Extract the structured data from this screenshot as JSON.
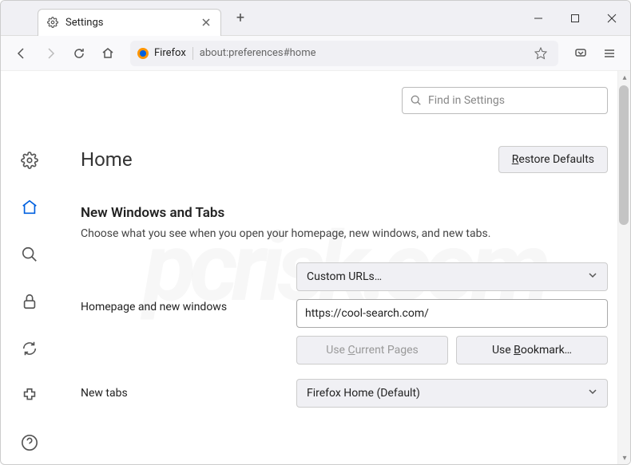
{
  "tab": {
    "title": "Settings"
  },
  "urlbar": {
    "identity": "Firefox",
    "url": "about:preferences#home"
  },
  "search": {
    "placeholder": "Find in Settings"
  },
  "page": {
    "title": "Home",
    "restore_label": "Restore Defaults"
  },
  "section": {
    "title": "New Windows and Tabs",
    "desc": "Choose what you see when you open your homepage, new windows, and new tabs."
  },
  "form": {
    "homepage_label": "Homepage and new windows",
    "homepage_mode": "Custom URLs…",
    "homepage_url": "https://cool-search.com/",
    "use_current": "Use Current Pages",
    "use_bookmark": "Use Bookmark…",
    "newtabs_label": "New tabs",
    "newtabs_mode": "Firefox Home (Default)"
  }
}
